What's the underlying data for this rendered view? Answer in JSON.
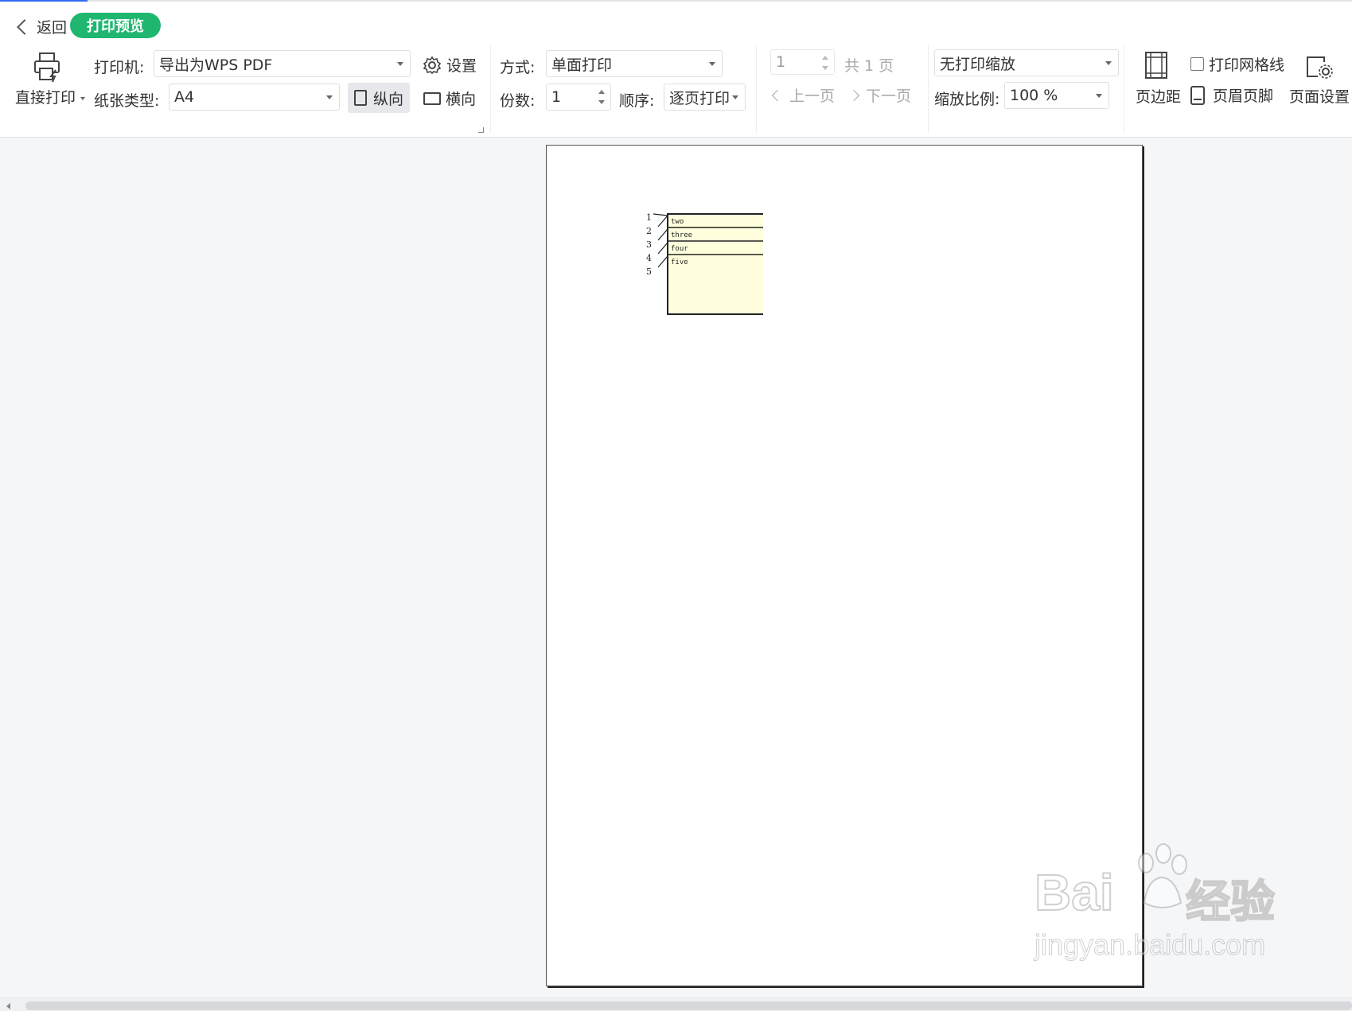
{
  "header": {
    "back_label": "返回",
    "title_pill": "打印预览"
  },
  "toolbar": {
    "direct_print": "直接打印",
    "printer_label": "打印机:",
    "printer_value": "导出为WPS PDF",
    "settings_label": "设置",
    "paper_label": "纸张类型:",
    "paper_value": "A4",
    "portrait_label": "纵向",
    "landscape_label": "横向",
    "mode_label": "方式:",
    "mode_value": "单面打印",
    "copies_label": "份数:",
    "copies_value": "1",
    "order_label": "顺序:",
    "order_value": "逐页打印",
    "page_value": "1",
    "total_pages": "共 1 页",
    "prev_page": "上一页",
    "next_page": "下一页",
    "scale_mode": "无打印缩放",
    "scale_label": "缩放比例:",
    "scale_value": "100 %",
    "margins": "页边距",
    "gridlines": "打印网格线",
    "header_footer": "页眉页脚",
    "page_setup": "页面设置"
  },
  "preview": {
    "row_numbers": [
      "1",
      "2",
      "3",
      "4",
      "5"
    ],
    "cells": [
      "two",
      "three",
      "four",
      "five"
    ],
    "cell_fill": "#ffffdd"
  },
  "watermark": {
    "brand": "Bai",
    "brand_cn": "经验",
    "url": "jingyan.baidu.com"
  },
  "colors": {
    "accent_green": "#1fb770",
    "accent_blue": "#2f6bf5"
  }
}
